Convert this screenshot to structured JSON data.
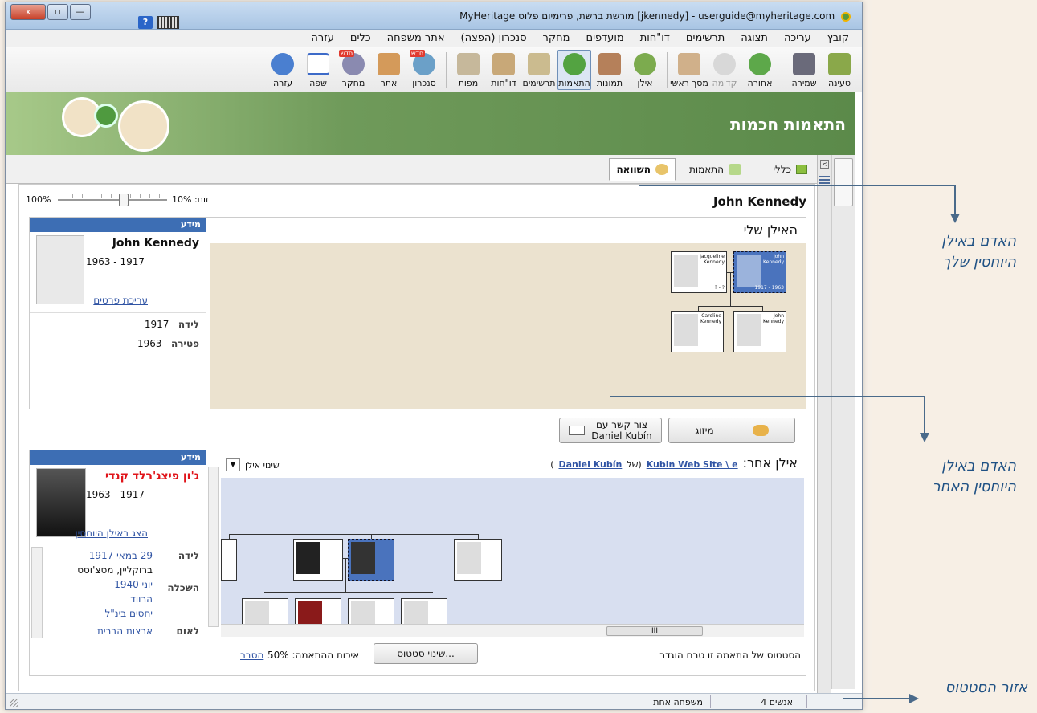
{
  "window": {
    "title": "jkennedy] - userguide@myheritage.com] מורשת ברשת, פרימיום פלוס MyHeritage",
    "close": "x",
    "maximize": "▫",
    "minimize": "—",
    "quick_help": "?"
  },
  "menu": [
    "קובץ",
    "עריכה",
    "תצוגה",
    "תרשימים",
    "דו\"חות",
    "מועדפים",
    "מחקר",
    "סנכרון (הפצה)",
    "אתר משפחה",
    "כלים",
    "עזרה"
  ],
  "toolbar": {
    "new_badge": "חדש",
    "buttons": [
      {
        "label": "טעינה",
        "icon": "folder-open-icon",
        "color": "#8aa84a"
      },
      {
        "label": "שמירה",
        "icon": "save-disk-icon",
        "color": "#6a6a7a"
      },
      {
        "label": "אחורה",
        "icon": "arrow-right-icon",
        "color": "#5da84a"
      },
      {
        "label": "קדימה",
        "icon": "arrow-left-icon",
        "color": "#c9c9c9"
      },
      {
        "label": "מסך ראשי",
        "icon": "home-icon",
        "color": "#d0b08a"
      },
      {
        "label": "אילן",
        "icon": "tree-icon",
        "color": "#7cab4e"
      },
      {
        "label": "תמונות",
        "icon": "photos-icon",
        "color": "#b5805a"
      },
      {
        "label": "התאמות",
        "icon": "sync-icon",
        "color": "#53a341"
      },
      {
        "label": "תרשימים",
        "icon": "chart-icon",
        "color": "#cbbb8f"
      },
      {
        "label": "דו\"חות",
        "icon": "report-icon",
        "color": "#c8a878"
      },
      {
        "label": "מפות",
        "icon": "map-icon",
        "color": "#c6b89b"
      },
      {
        "label": "סנכרון",
        "icon": "sync-publish-icon",
        "color": "#6ba0c8"
      },
      {
        "label": "אתר",
        "icon": "family-site-icon",
        "color": "#d49a5a"
      },
      {
        "label": "מחקר",
        "icon": "research-icon",
        "color": "#8a8ab0"
      },
      {
        "label": "שפה",
        "icon": "israel-flag-icon",
        "color": "#3c6ac8"
      },
      {
        "label": "עזרה",
        "icon": "help-icon",
        "color": "#4a7fd0"
      }
    ]
  },
  "banner": {
    "title": "התאמות חכמות"
  },
  "tabs": [
    {
      "label": "כללי",
      "icon": "general-icon"
    },
    {
      "label": "התאמות",
      "icon": "matches-icon"
    },
    {
      "label": "השוואה",
      "icon": "compare-icon",
      "active": true
    }
  ],
  "zoom": {
    "label": "זום: 10%",
    "max": "100%"
  },
  "person_title": "John Kennedy",
  "my_tree": {
    "title": "האילן שלי",
    "info_header": "מידע",
    "name": "John Kennedy",
    "years": "1963 - 1917",
    "edit_link": "עריכת פרטים",
    "birth_label": "לידה",
    "birth_value": "1917",
    "death_label": "פטירה",
    "death_value": "1963",
    "boxes": [
      {
        "name": "Jacqueline",
        "surname": "Kennedy",
        "dates": "? - ?"
      },
      {
        "name": "John",
        "surname": "Kennedy",
        "dates": "1917 - 1963"
      },
      {
        "name": "Caroline",
        "surname": "Kennedy",
        "dates": ""
      },
      {
        "name": "John",
        "surname": "Kennedy",
        "dates": ""
      }
    ]
  },
  "actions": {
    "contact_label": "צור קשר עם",
    "contact_name": "Daniel Kubín",
    "merge_label": "מיזוג"
  },
  "other_tree": {
    "title": "אילן אחר:",
    "site_link": "Kubin Web Site \\ e",
    "of_label": "(של",
    "owner_link": "Daniel Kubín",
    "close_paren": ")",
    "change_tree": "שינוי אילן",
    "info_header": "מידע",
    "name": "ג'ון פיצג'רלד קנדי",
    "years": "1963 - 1917",
    "show_link": "הצג באילן היוחסין",
    "birth_label": "לידה",
    "birth_date": "29 במאי 1917",
    "birth_place": "ברוקליין, מסצ'וסס",
    "edu_label": "השכלה",
    "edu_date": "יוני 1940",
    "edu_place": "הרווד",
    "edu_desc": "יחסים בינ\"ל",
    "nation_label": "לאום",
    "nation_value": "ארצות הברית",
    "scroll_thumb": "III"
  },
  "match_status": {
    "text": "הסטטוס של התאמה זו טרם הוגדר",
    "button": "...שינוי סטטוס",
    "quality_label": "איכות ההתאמה: 50%",
    "explain_link": "הסבר"
  },
  "statusbar": {
    "people": "4 אנשים",
    "families": "משפחה אחת"
  },
  "annotations": {
    "my_tree_line1": "האדם באילן",
    "my_tree_line2": "היוחסין שלך",
    "other_tree_line1": "האדם באילן",
    "other_tree_line2": "היוחסין האחר",
    "status_area": "אזור הסטטוס"
  }
}
